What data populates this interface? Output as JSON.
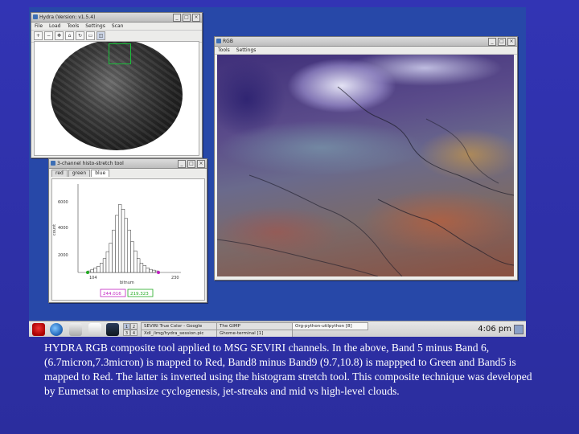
{
  "colors": {
    "slide_background": "#2d2fa8",
    "roi_box": "#19c03a",
    "hist_bar": "#ffffff",
    "green_marker": "#22aa22",
    "magenta_marker": "#c020c0"
  },
  "hydra_window": {
    "title": "Hydra (Version: v1.5.4)",
    "menu": [
      "File",
      "Load",
      "Tools",
      "Settings",
      "Scan"
    ],
    "toolbar_icons": [
      "zoom-in-icon",
      "zoom-out-icon",
      "pan-icon",
      "home-icon",
      "rotate-icon",
      "select-icon",
      "roi-icon"
    ]
  },
  "rgb_window": {
    "title": "RGB",
    "menu": [
      "Tools",
      "Settings"
    ]
  },
  "histogram_window": {
    "title": "3-channel histo-stretch tool",
    "tabs": [
      "red",
      "green",
      "blue"
    ],
    "active_tab": "blue",
    "y_ticks": [
      "6000",
      "4000",
      "2000"
    ],
    "y_label": "count",
    "x_ticks": [
      "104",
      "230"
    ],
    "x_label": "bitnum",
    "low_value": "244.016",
    "high_value": "219.323",
    "bars": [
      0.02,
      0.04,
      0.06,
      0.08,
      0.12,
      0.18,
      0.27,
      0.38,
      0.55,
      0.74,
      0.88,
      0.82,
      0.7,
      0.55,
      0.4,
      0.28,
      0.18,
      0.12,
      0.09,
      0.06,
      0.04,
      0.03,
      0.02
    ]
  },
  "taskbar": {
    "workspaces": [
      "1",
      "2",
      "3",
      "4"
    ],
    "active_workspace": "1",
    "tasks": [
      {
        "label": "SEVIRI True Color - Google"
      },
      {
        "label": "The GIMP"
      },
      {
        "label": "Org-python-utilpython [8]"
      },
      {
        "label": "Xdl_/img/hydra_session.pic"
      },
      {
        "label": "Ghome-terminal [1]"
      }
    ],
    "clock": "4:06 pm"
  },
  "caption": "HYDRA RGB composite tool applied to MSG SEVIRI channels.   In the above, Band 5 minus Band 6, (6.7micron,7.3micron) is mapped to Red, Band8 minus Band9 (9.7,10.8) is mappped to Green and Band5 is mapped to Red.  The latter is inverted using the histogram stretch tool.  This composite technique was developed by Eumetsat to emphasize cyclogenesis, jet-streaks and mid vs high-level clouds."
}
